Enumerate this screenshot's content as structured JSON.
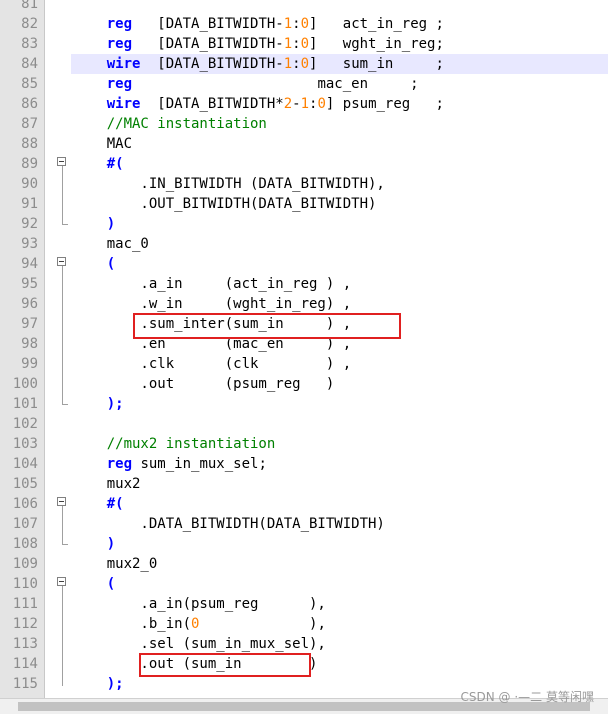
{
  "lines": [
    {
      "n": "81",
      "hl": false,
      "segs": [
        {
          "t": "",
          "c": "txt"
        }
      ]
    },
    {
      "n": "82",
      "hl": false,
      "segs": [
        {
          "t": "    ",
          "c": "txt"
        },
        {
          "t": "reg",
          "c": "kw"
        },
        {
          "t": "   [DATA_BITWIDTH-",
          "c": "txt"
        },
        {
          "t": "1",
          "c": "num"
        },
        {
          "t": ":",
          "c": "txt"
        },
        {
          "t": "0",
          "c": "num"
        },
        {
          "t": "]   act_in_reg ;",
          "c": "txt"
        }
      ]
    },
    {
      "n": "83",
      "hl": false,
      "segs": [
        {
          "t": "    ",
          "c": "txt"
        },
        {
          "t": "reg",
          "c": "kw"
        },
        {
          "t": "   [DATA_BITWIDTH-",
          "c": "txt"
        },
        {
          "t": "1",
          "c": "num"
        },
        {
          "t": ":",
          "c": "txt"
        },
        {
          "t": "0",
          "c": "num"
        },
        {
          "t": "]   wght_in_reg;",
          "c": "txt"
        }
      ]
    },
    {
      "n": "84",
      "hl": true,
      "segs": [
        {
          "t": "    ",
          "c": "txt"
        },
        {
          "t": "wire",
          "c": "kw"
        },
        {
          "t": "  [DATA_BITWIDTH-",
          "c": "txt"
        },
        {
          "t": "1",
          "c": "num"
        },
        {
          "t": ":",
          "c": "txt"
        },
        {
          "t": "0",
          "c": "num"
        },
        {
          "t": "]   sum_in     ;",
          "c": "txt"
        }
      ]
    },
    {
      "n": "85",
      "hl": false,
      "segs": [
        {
          "t": "    ",
          "c": "txt"
        },
        {
          "t": "reg",
          "c": "kw"
        },
        {
          "t": "                      mac_en     ;",
          "c": "txt"
        }
      ]
    },
    {
      "n": "86",
      "hl": false,
      "segs": [
        {
          "t": "    ",
          "c": "txt"
        },
        {
          "t": "wire",
          "c": "kw"
        },
        {
          "t": "  [DATA_BITWIDTH*",
          "c": "txt"
        },
        {
          "t": "2",
          "c": "num"
        },
        {
          "t": "-",
          "c": "txt"
        },
        {
          "t": "1",
          "c": "num"
        },
        {
          "t": ":",
          "c": "txt"
        },
        {
          "t": "0",
          "c": "num"
        },
        {
          "t": "] psum_reg   ;",
          "c": "txt"
        }
      ]
    },
    {
      "n": "87",
      "hl": false,
      "segs": [
        {
          "t": "    ",
          "c": "txt"
        },
        {
          "t": "//MAC instantiation",
          "c": "cm"
        }
      ]
    },
    {
      "n": "88",
      "hl": false,
      "segs": [
        {
          "t": "    MAC",
          "c": "txt"
        }
      ]
    },
    {
      "n": "89",
      "hl": false,
      "segs": [
        {
          "t": "    ",
          "c": "txt"
        },
        {
          "t": "#(",
          "c": "kw"
        }
      ]
    },
    {
      "n": "90",
      "hl": false,
      "segs": [
        {
          "t": "        .IN_BITWIDTH (DATA_BITWIDTH),",
          "c": "txt"
        }
      ]
    },
    {
      "n": "91",
      "hl": false,
      "segs": [
        {
          "t": "        .OUT_BITWIDTH(DATA_BITWIDTH)",
          "c": "txt"
        }
      ]
    },
    {
      "n": "92",
      "hl": false,
      "segs": [
        {
          "t": "    ",
          "c": "txt"
        },
        {
          "t": ")",
          "c": "kw"
        }
      ]
    },
    {
      "n": "93",
      "hl": false,
      "segs": [
        {
          "t": "    mac_0",
          "c": "txt"
        }
      ]
    },
    {
      "n": "94",
      "hl": false,
      "segs": [
        {
          "t": "    ",
          "c": "txt"
        },
        {
          "t": "(",
          "c": "kw"
        }
      ]
    },
    {
      "n": "95",
      "hl": false,
      "segs": [
        {
          "t": "        .a_in     (act_in_reg ) ,",
          "c": "txt"
        }
      ]
    },
    {
      "n": "96",
      "hl": false,
      "segs": [
        {
          "t": "        .w_in     (wght_in_reg) ,",
          "c": "txt"
        }
      ]
    },
    {
      "n": "97",
      "hl": false,
      "segs": [
        {
          "t": "        .sum_inter(sum_in     ) ,",
          "c": "txt"
        }
      ]
    },
    {
      "n": "98",
      "hl": false,
      "segs": [
        {
          "t": "        .en       (mac_en     ) ,",
          "c": "txt"
        }
      ]
    },
    {
      "n": "99",
      "hl": false,
      "segs": [
        {
          "t": "        .clk      (clk        ) ,",
          "c": "txt"
        }
      ]
    },
    {
      "n": "100",
      "hl": false,
      "segs": [
        {
          "t": "        .out      (psum_reg   )",
          "c": "txt"
        }
      ]
    },
    {
      "n": "101",
      "hl": false,
      "segs": [
        {
          "t": "    ",
          "c": "txt"
        },
        {
          "t": ");",
          "c": "kw"
        }
      ]
    },
    {
      "n": "102",
      "hl": false,
      "segs": [
        {
          "t": "",
          "c": "txt"
        }
      ]
    },
    {
      "n": "103",
      "hl": false,
      "segs": [
        {
          "t": "    ",
          "c": "txt"
        },
        {
          "t": "//mux2 instantiation",
          "c": "cm"
        }
      ]
    },
    {
      "n": "104",
      "hl": false,
      "segs": [
        {
          "t": "    ",
          "c": "txt"
        },
        {
          "t": "reg",
          "c": "kw"
        },
        {
          "t": " sum_in_mux_sel;",
          "c": "txt"
        }
      ]
    },
    {
      "n": "105",
      "hl": false,
      "segs": [
        {
          "t": "    mux2",
          "c": "txt"
        }
      ]
    },
    {
      "n": "106",
      "hl": false,
      "segs": [
        {
          "t": "    ",
          "c": "txt"
        },
        {
          "t": "#(",
          "c": "kw"
        }
      ]
    },
    {
      "n": "107",
      "hl": false,
      "segs": [
        {
          "t": "        .DATA_BITWIDTH(DATA_BITWIDTH)",
          "c": "txt"
        }
      ]
    },
    {
      "n": "108",
      "hl": false,
      "segs": [
        {
          "t": "    ",
          "c": "txt"
        },
        {
          "t": ")",
          "c": "kw"
        }
      ]
    },
    {
      "n": "109",
      "hl": false,
      "segs": [
        {
          "t": "    mux2_0",
          "c": "txt"
        }
      ]
    },
    {
      "n": "110",
      "hl": false,
      "segs": [
        {
          "t": "    ",
          "c": "txt"
        },
        {
          "t": "(",
          "c": "kw"
        }
      ]
    },
    {
      "n": "111",
      "hl": false,
      "segs": [
        {
          "t": "        .a_in(psum_reg      ),",
          "c": "txt"
        }
      ]
    },
    {
      "n": "112",
      "hl": false,
      "segs": [
        {
          "t": "        .b_in(",
          "c": "txt"
        },
        {
          "t": "0",
          "c": "num"
        },
        {
          "t": "             ),",
          "c": "txt"
        }
      ]
    },
    {
      "n": "113",
      "hl": false,
      "segs": [
        {
          "t": "        .sel (sum_in_mux_sel),",
          "c": "txt"
        }
      ]
    },
    {
      "n": "114",
      "hl": false,
      "segs": [
        {
          "t": "        .out (sum_in        )",
          "c": "txt"
        }
      ]
    },
    {
      "n": "115",
      "hl": false,
      "segs": [
        {
          "t": "    ",
          "c": "txt"
        },
        {
          "t": ");",
          "c": "kw"
        }
      ]
    }
  ],
  "watermark": "CSDN @ ·—二 莫等闲嘿",
  "colors": {
    "keyword": "#0000ff",
    "number": "#ff8000",
    "comment": "#008000",
    "highlight": "#e8e8ff",
    "annotation_box": "#e02020"
  }
}
